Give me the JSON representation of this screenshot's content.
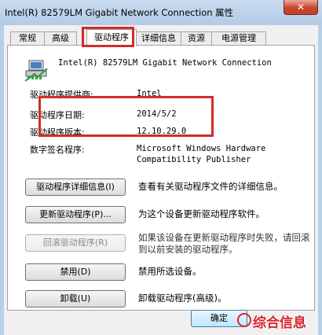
{
  "window": {
    "title": "Intel(R) 82579LM Gigabit Network Connection 属性",
    "close_label": "✕"
  },
  "tabs": [
    {
      "label": "常规"
    },
    {
      "label": "高级"
    },
    {
      "label": "驱动程序"
    },
    {
      "label": "详细信息"
    },
    {
      "label": "资源"
    },
    {
      "label": "电源管理"
    }
  ],
  "active_tab": "驱动程序",
  "device": {
    "icon": "network-adapter-icon",
    "name": "Intel(R) 82579LM Gigabit Network Connection"
  },
  "driver_info": {
    "provider_label": "驱动程序提供商:",
    "provider_value": "Intel",
    "date_label": "驱动程序日期:",
    "date_value": "2014/5/2",
    "version_label": "驱动程序版本:",
    "version_value": "12.10.29.0",
    "signer_label": "数字签名程序:",
    "signer_value_line1": "Microsoft Windows Hardware",
    "signer_value_line2": "Compatibility Publisher"
  },
  "actions": [
    {
      "button": "驱动程序详细信息(I)",
      "description": "查看有关驱动程序文件的详细信息。",
      "enabled": true
    },
    {
      "button": "更新驱动程序(P)...",
      "description": "为这个设备更新驱动程序软件。",
      "enabled": true
    },
    {
      "button": "回滚驱动程序(R)",
      "description": "如果该设备在更新驱动程序时失败，请回滚到以前安装的驱动程序。",
      "enabled": false
    },
    {
      "button": "禁用(D)",
      "description": "禁用所选设备。",
      "enabled": true
    },
    {
      "button": "卸载(U)",
      "description": "卸载驱动程序(高级)。",
      "enabled": true
    }
  ],
  "footer": {
    "ok_label": "确定"
  },
  "watermark": {
    "text": "综合信息"
  },
  "colors": {
    "highlight": "#d62a2a",
    "watermark": "#d8262c"
  }
}
